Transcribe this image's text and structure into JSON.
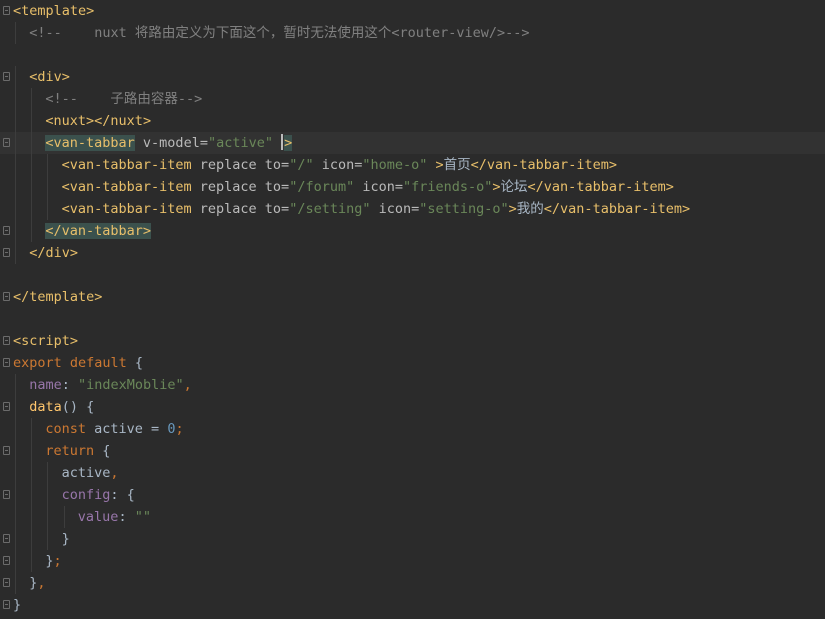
{
  "editor": {
    "lines": [
      {
        "indent": 0,
        "fold": "open",
        "tokens": [
          {
            "k": "tag",
            "t": "<template>"
          }
        ]
      },
      {
        "indent": 1,
        "tokens": [
          {
            "k": "cmt",
            "t": "<!--    nuxt 将路由定义为下面这个，暂时无法使用这个<router-view/>-->"
          }
        ]
      },
      {
        "indent": 0,
        "tokens": []
      },
      {
        "indent": 1,
        "fold": "open",
        "tokens": [
          {
            "k": "tag",
            "t": "<div>"
          }
        ]
      },
      {
        "indent": 2,
        "tokens": [
          {
            "k": "cmt",
            "t": "<!--    子路由容器-->"
          }
        ]
      },
      {
        "indent": 2,
        "tokens": [
          {
            "k": "tag",
            "t": "<nuxt>"
          },
          {
            "k": "tag",
            "t": "</nuxt>"
          }
        ]
      },
      {
        "indent": 2,
        "fold": "open",
        "current": true,
        "tokens": [
          {
            "k": "tag",
            "t": "<van-tabbar",
            "m": true
          },
          {
            "k": "attr",
            "t": " v-model="
          },
          {
            "k": "val",
            "t": "\"active\""
          },
          {
            "k": "txt",
            "t": " "
          },
          {
            "k": "caret",
            "t": ""
          },
          {
            "k": "tag",
            "t": ">",
            "m": true
          }
        ]
      },
      {
        "indent": 3,
        "tokens": [
          {
            "k": "tag",
            "t": "<van-tabbar-item"
          },
          {
            "k": "attr",
            "t": " replace to="
          },
          {
            "k": "val",
            "t": "\"/\""
          },
          {
            "k": "attr",
            "t": " icon="
          },
          {
            "k": "val",
            "t": "\"home-o\""
          },
          {
            "k": "tag",
            "t": " >"
          },
          {
            "k": "txt",
            "t": "首页"
          },
          {
            "k": "tag",
            "t": "</van-tabbar-item>"
          }
        ]
      },
      {
        "indent": 3,
        "tokens": [
          {
            "k": "tag",
            "t": "<van-tabbar-item"
          },
          {
            "k": "attr",
            "t": " replace to="
          },
          {
            "k": "val",
            "t": "\"/forum\""
          },
          {
            "k": "attr",
            "t": " icon="
          },
          {
            "k": "val",
            "t": "\"friends-o\""
          },
          {
            "k": "tag",
            "t": ">"
          },
          {
            "k": "txt",
            "t": "论坛"
          },
          {
            "k": "tag",
            "t": "</van-tabbar-item>"
          }
        ]
      },
      {
        "indent": 3,
        "tokens": [
          {
            "k": "tag",
            "t": "<van-tabbar-item"
          },
          {
            "k": "attr",
            "t": " replace to="
          },
          {
            "k": "val",
            "t": "\"/setting\""
          },
          {
            "k": "attr",
            "t": " icon="
          },
          {
            "k": "val",
            "t": "\"setting-o\""
          },
          {
            "k": "tag",
            "t": ">"
          },
          {
            "k": "txt",
            "t": "我的"
          },
          {
            "k": "tag",
            "t": "</van-tabbar-item>"
          }
        ]
      },
      {
        "indent": 2,
        "fold": "close",
        "tokens": [
          {
            "k": "tag",
            "t": "</van-tabbar>",
            "m": true
          }
        ]
      },
      {
        "indent": 1,
        "fold": "close",
        "tokens": [
          {
            "k": "tag",
            "t": "</div>"
          }
        ]
      },
      {
        "indent": 0,
        "tokens": []
      },
      {
        "indent": 0,
        "fold": "close",
        "tokens": [
          {
            "k": "tag",
            "t": "</template>"
          }
        ]
      },
      {
        "indent": 0,
        "tokens": []
      },
      {
        "indent": 0,
        "fold": "open",
        "tokens": [
          {
            "k": "tag",
            "t": "<script>"
          }
        ]
      },
      {
        "indent": 0,
        "fold": "open",
        "tokens": [
          {
            "k": "kw",
            "t": "export default"
          },
          {
            "k": "punc",
            "t": " {"
          }
        ]
      },
      {
        "indent": 1,
        "tokens": [
          {
            "k": "prop",
            "t": "name"
          },
          {
            "k": "punc",
            "t": ": "
          },
          {
            "k": "val",
            "t": "\"indexMoblie\""
          },
          {
            "k": "kw",
            "t": ","
          }
        ]
      },
      {
        "indent": 1,
        "fold": "open",
        "tokens": [
          {
            "k": "fn",
            "t": "data"
          },
          {
            "k": "punc",
            "t": "() {"
          }
        ]
      },
      {
        "indent": 2,
        "tokens": [
          {
            "k": "kw",
            "t": "const"
          },
          {
            "k": "txt",
            "t": " active = "
          },
          {
            "k": "num",
            "t": "0"
          },
          {
            "k": "kw",
            "t": ";"
          }
        ]
      },
      {
        "indent": 2,
        "fold": "open",
        "tokens": [
          {
            "k": "kw",
            "t": "return"
          },
          {
            "k": "punc",
            "t": " {"
          }
        ]
      },
      {
        "indent": 3,
        "tokens": [
          {
            "k": "txt",
            "t": "active"
          },
          {
            "k": "kw",
            "t": ","
          }
        ]
      },
      {
        "indent": 3,
        "fold": "open",
        "tokens": [
          {
            "k": "prop",
            "t": "config"
          },
          {
            "k": "punc",
            "t": ": {"
          }
        ]
      },
      {
        "indent": 4,
        "tokens": [
          {
            "k": "prop",
            "t": "value"
          },
          {
            "k": "punc",
            "t": ": "
          },
          {
            "k": "val",
            "t": "\"\""
          }
        ]
      },
      {
        "indent": 3,
        "fold": "close",
        "tokens": [
          {
            "k": "punc",
            "t": "}"
          }
        ]
      },
      {
        "indent": 2,
        "fold": "close",
        "tokens": [
          {
            "k": "punc",
            "t": "}"
          },
          {
            "k": "kw",
            "t": ";"
          }
        ]
      },
      {
        "indent": 1,
        "fold": "close",
        "tokens": [
          {
            "k": "punc",
            "t": "}"
          },
          {
            "k": "kw",
            "t": ","
          }
        ]
      },
      {
        "indent": 0,
        "fold": "close",
        "tokens": [
          {
            "k": "punc",
            "t": "}"
          }
        ]
      }
    ]
  }
}
